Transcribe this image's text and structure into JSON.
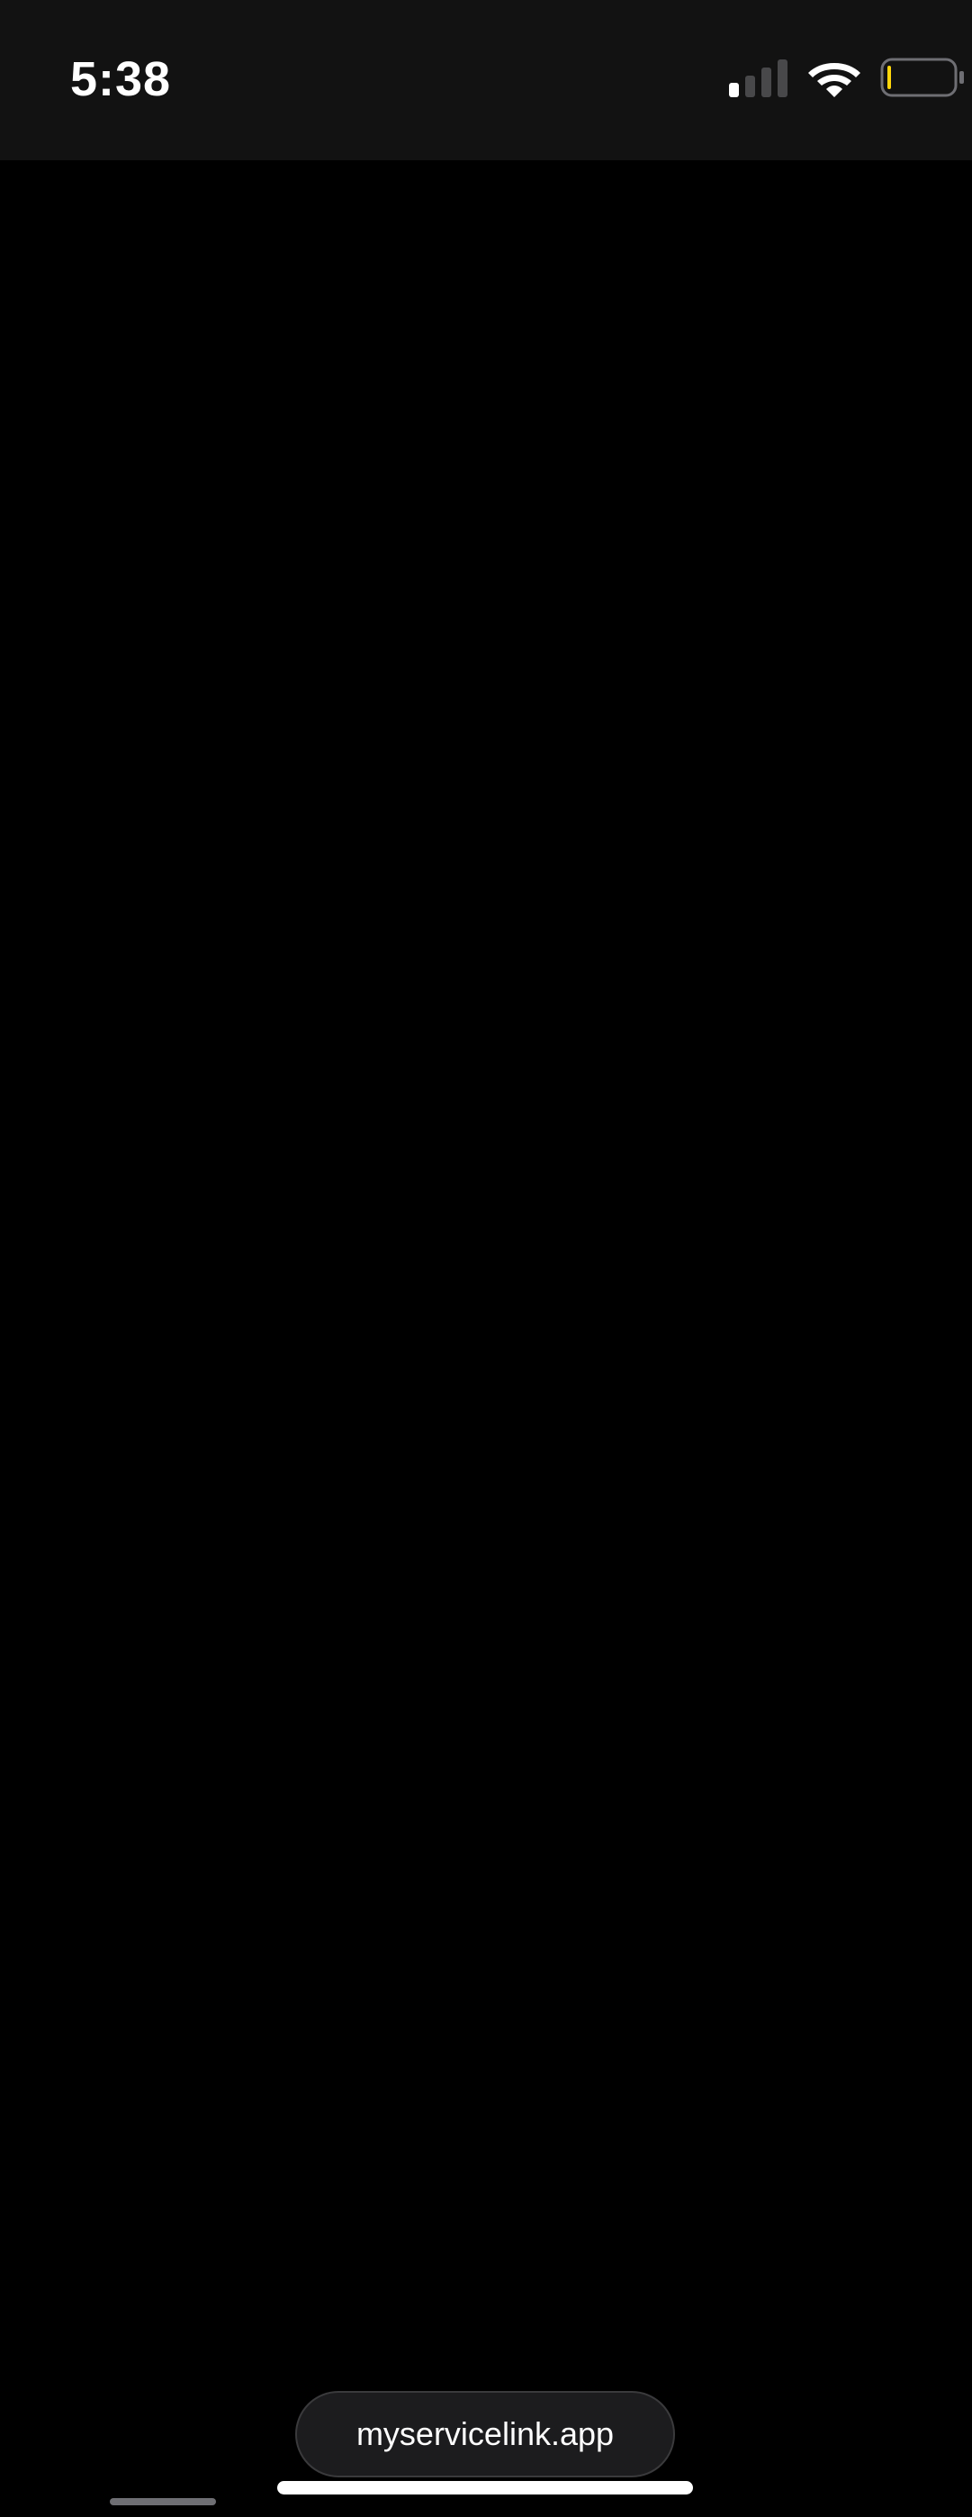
{
  "status_bar": {
    "time": "5:38",
    "signal_icon": "cellular-signal-icon",
    "signal_bars_active": 1,
    "signal_bars_total": 4,
    "wifi_icon": "wifi-icon",
    "battery_icon": "battery-icon",
    "battery_level": 0.05,
    "battery_color": "#ffd60a",
    "background": "#121212"
  },
  "page": {
    "background": "#000000"
  },
  "browser": {
    "url": "myservicelink.app"
  }
}
